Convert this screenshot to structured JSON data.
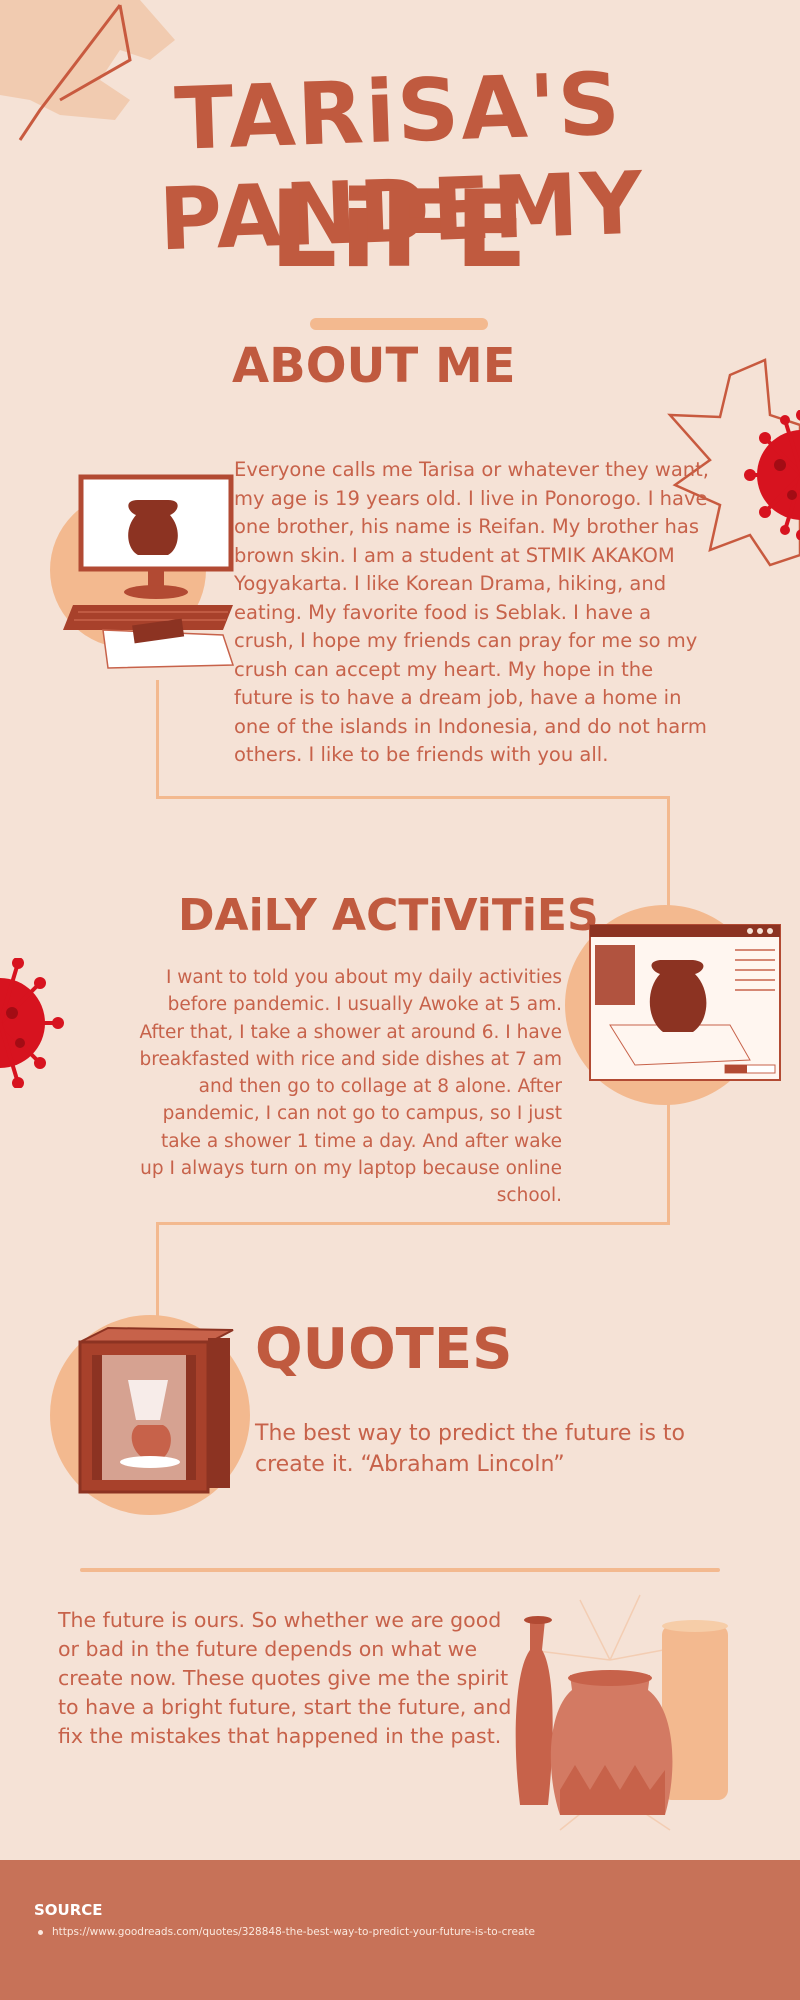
{
  "title": {
    "line1": "TARiSA'S PANDEMY",
    "line2": "LiFE"
  },
  "about": {
    "heading": "ABOUT ME",
    "text": "Everyone calls me Tarisa or whatever they want, my age is 19 years old. I live in Ponorogo. I have one brother, his name is Reifan. My brother has brown skin. I am a student at STMIK AKAKOM Yogyakarta. I like Korean Drama, hiking, and eating. My favorite food is Seblak. I have a crush, I hope my friends can pray for me so my crush can accept my heart. My hope in the future is to have a dream job, have a home in one of the islands in Indonesia, and do not harm others. I like to be friends with you all."
  },
  "daily": {
    "heading": "DAiLY ACTiViTiES",
    "text": "I want to told you about my daily activities before pandemic. I usually Awoke at 5 am. After that, I take a shower at around 6. I have breakfasted with rice and side dishes at 7 am and then go to collage at 8 alone. After pandemic, I can not go to campus, so I just take a shower 1 time a day. And after wake up I always turn on my laptop because online school."
  },
  "quotes": {
    "heading": "QUOTES",
    "text": "The best way to predict the future is to create it. “Abraham Lincoln”"
  },
  "future": {
    "text": "The future is ours. So whether we are good or bad in the future depends on what we create now. These quotes give me the spirit to have a bright future, start the future, and fix the mistakes that happened in the past."
  },
  "footer": {
    "source_label": "SOURCE",
    "link": "https://www.goodreads.com/quotes/328848-the-best-way-to-predict-your-future-is-to-create"
  },
  "colors": {
    "background": "#f5e2d6",
    "accent": "#c85a3f",
    "light_accent": "#f3b98f",
    "footer": "#c77258",
    "virus": "#d7131f"
  },
  "icons": [
    "star-outline-icon",
    "virus-icon",
    "computer-vase-illustration",
    "web-vase-illustration",
    "kiln-vase-illustration",
    "vases-illustration"
  ]
}
